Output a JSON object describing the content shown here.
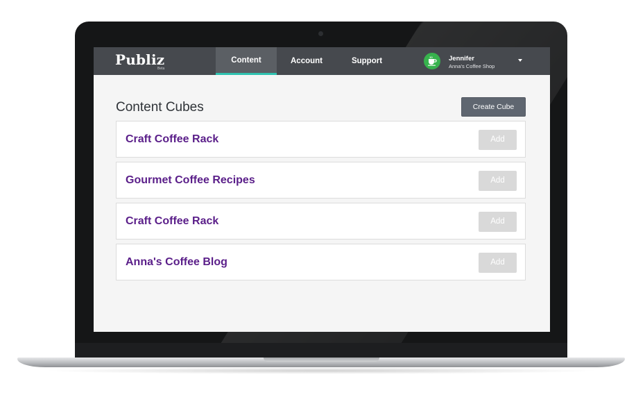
{
  "brand": {
    "name": "Publiz",
    "badge": "Beta"
  },
  "nav": {
    "tabs": [
      {
        "label": "Content",
        "active": true
      },
      {
        "label": "Account",
        "active": false
      },
      {
        "label": "Support",
        "active": false
      }
    ]
  },
  "user": {
    "name": "Jennifer",
    "business": "Anna's Coffee Shop",
    "avatar_icon": "coffee-cup-icon",
    "avatar_color": "#37b24d",
    "menu_icon": "caret-down-icon"
  },
  "main": {
    "title": "Content Cubes",
    "create_label": "Create Cube",
    "cubes": [
      {
        "name": "Craft Coffee Rack",
        "action": "Add"
      },
      {
        "name": "Gourmet Coffee Recipes",
        "action": "Add"
      },
      {
        "name": "Craft Coffee Rack",
        "action": "Add"
      },
      {
        "name": "Anna's Coffee Blog",
        "action": "Add"
      }
    ]
  },
  "colors": {
    "navbar": "#46494e",
    "active_tab_underline": "#2fc2b0",
    "cube_title": "#5a1e89",
    "add_button": "#d9d9d9",
    "create_button": "#5f6670"
  }
}
